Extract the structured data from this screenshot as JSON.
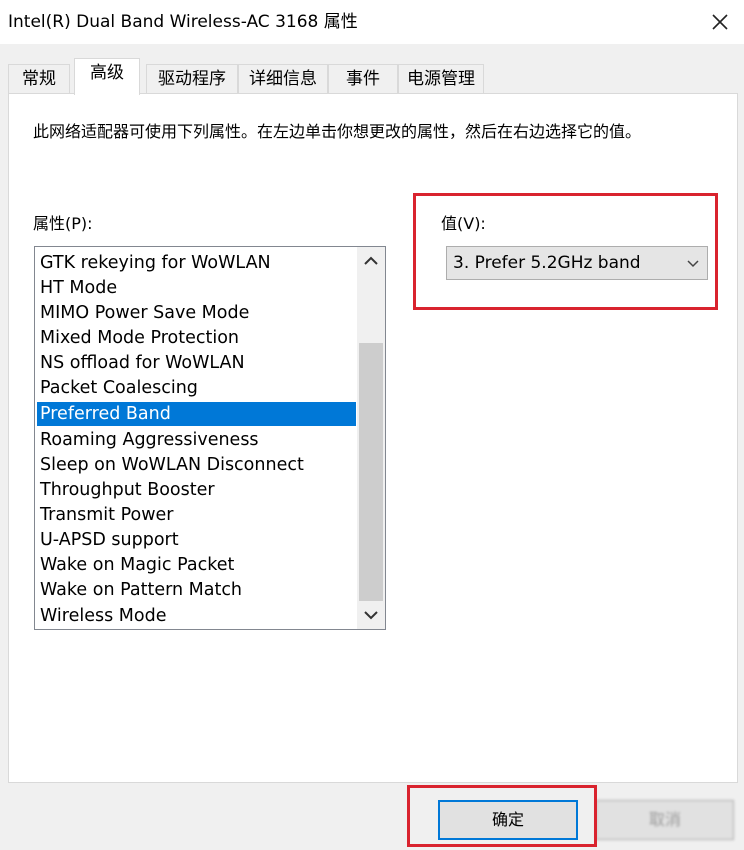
{
  "window": {
    "title": "Intel(R) Dual Band Wireless-AC 3168 属性"
  },
  "tabs": [
    {
      "label": "常规"
    },
    {
      "label": "高级"
    },
    {
      "label": "驱动程序"
    },
    {
      "label": "详细信息"
    },
    {
      "label": "事件"
    },
    {
      "label": "电源管理"
    }
  ],
  "active_tab": "高级",
  "advanced": {
    "description": "此网络适配器可使用下列属性。在左边单击你想更改的属性，然后在右边选择它的值。",
    "property_label": "属性(P):",
    "value_label": "值(V):",
    "properties": [
      "GTK rekeying for WoWLAN",
      "HT Mode",
      "MIMO Power Save Mode",
      "Mixed Mode Protection",
      "NS offload for WoWLAN",
      "Packet Coalescing",
      "Preferred Band",
      "Roaming Aggressiveness",
      "Sleep on WoWLAN Disconnect",
      "Throughput Booster",
      "Transmit Power",
      "U-APSD support",
      "Wake on Magic Packet",
      "Wake on Pattern Match",
      "Wireless Mode"
    ],
    "selected_property": "Preferred Band",
    "value_selected": "3. Prefer 5.2GHz band"
  },
  "buttons": {
    "ok": "确定",
    "cancel": "取消"
  },
  "icons": {
    "close": "close-icon",
    "scroll_up": "chevron-up-icon",
    "scroll_down": "chevron-down-icon",
    "dropdown": "chevron-down-icon"
  },
  "colors": {
    "selection": "#0078d7",
    "highlight_box": "#d9232e",
    "window_bg": "#f0f0f0"
  }
}
